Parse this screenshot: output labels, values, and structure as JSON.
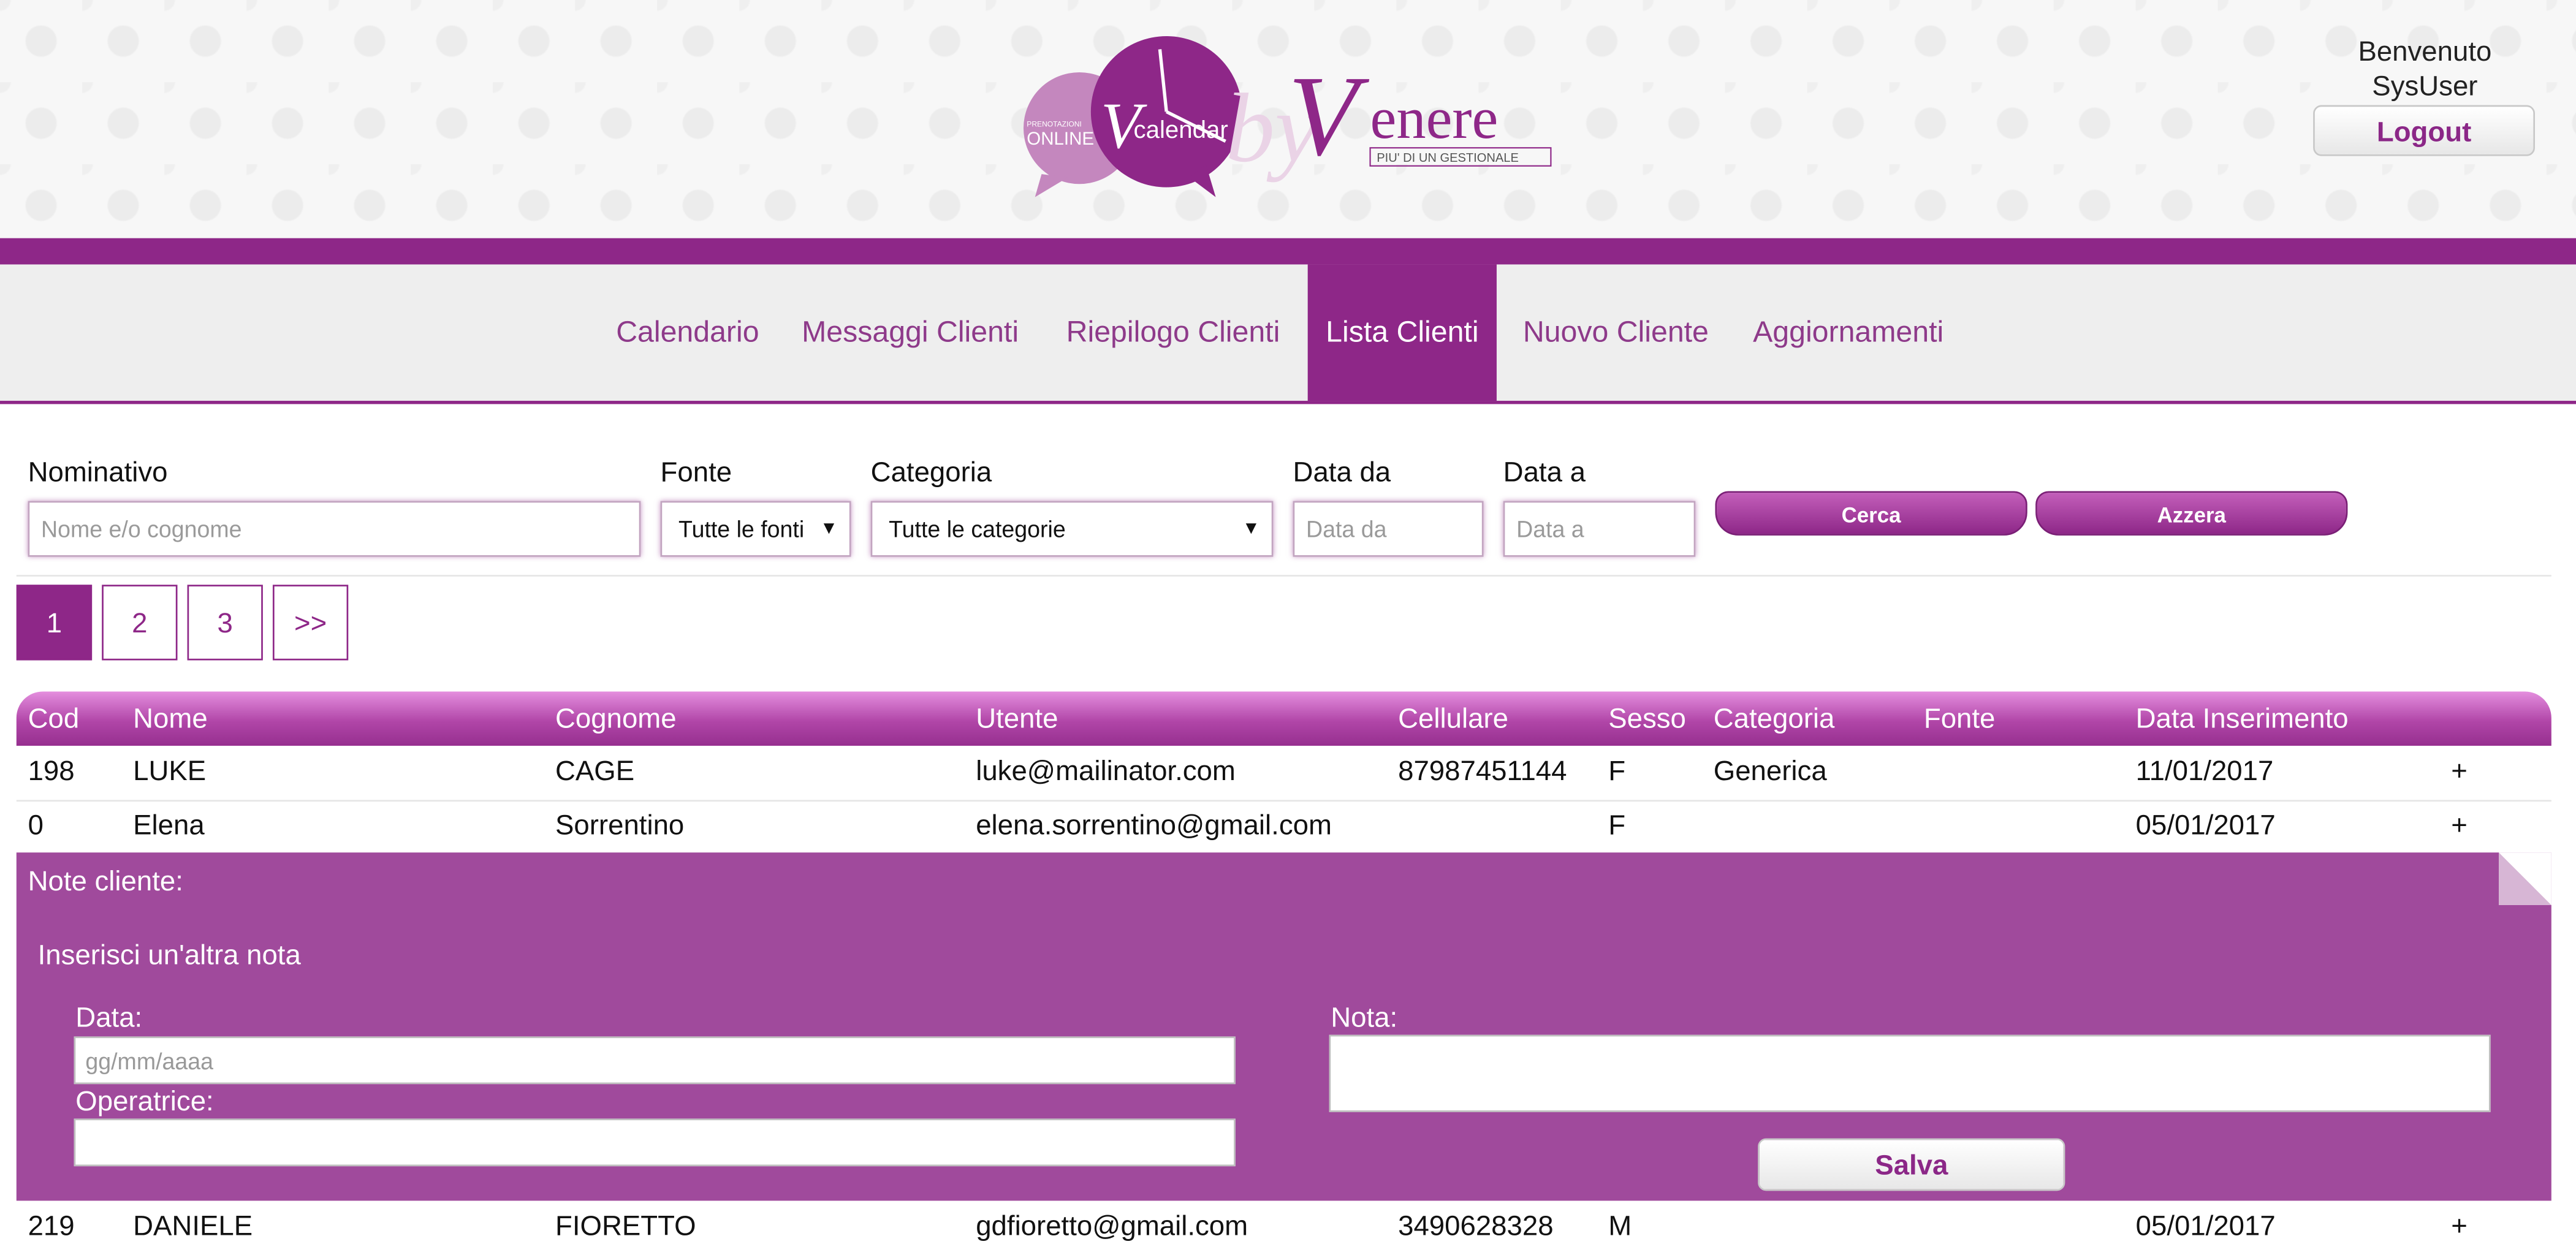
{
  "header": {
    "logo": {
      "badge_text": "PRENOTAZIONI",
      "online_text": "ONLINE",
      "app_name": "calendar",
      "app_initial": "V",
      "by_text": "by",
      "brand_initial": "V",
      "brand_rest": "enere",
      "tagline": "PIU' DI UN GESTIONALE"
    },
    "welcome_line1": "Benvenuto",
    "welcome_line2": "SysUser",
    "logout_label": "Logout"
  },
  "nav": {
    "items": [
      {
        "label": "Calendario"
      },
      {
        "label": "Messaggi Clienti"
      },
      {
        "label": "Riepilogo Clienti"
      },
      {
        "label": "Lista Clienti"
      },
      {
        "label": "Nuovo Cliente"
      },
      {
        "label": "Aggiornamenti"
      }
    ],
    "active": "Lista Clienti"
  },
  "filters": {
    "nominativo_label": "Nominativo",
    "nominativo_placeholder": "Nome e/o cognome",
    "fonte_label": "Fonte",
    "fonte_value": "Tutte le fonti",
    "categoria_label": "Categoria",
    "categoria_value": "Tutte le categorie",
    "data_da_label": "Data da",
    "data_da_placeholder": "Data da",
    "data_a_label": "Data a",
    "data_a_placeholder": "Data a",
    "cerca_label": "Cerca",
    "azzera_label": "Azzera"
  },
  "pagination": {
    "pages": [
      "1",
      "2",
      "3",
      ">>"
    ],
    "current": "1"
  },
  "table": {
    "headers": [
      "Cod",
      "Nome",
      "Cognome",
      "Utente",
      "Cellulare",
      "Sesso",
      "Categoria",
      "Fonte",
      "Data Inserimento"
    ],
    "rows": [
      {
        "cod": "198",
        "nome": "LUKE",
        "cognome": "CAGE",
        "utente": "luke@mailinator.com",
        "cellulare": "87987451144",
        "sesso": "F",
        "categoria": "Generica",
        "fonte": "",
        "data": "11/01/2017",
        "action": "+"
      },
      {
        "cod": "0",
        "nome": "Elena",
        "cognome": "Sorrentino",
        "utente": "elena.sorrentino@gmail.com",
        "cellulare": "",
        "sesso": "F",
        "categoria": "",
        "fonte": "",
        "data": "05/01/2017",
        "action": "+"
      },
      {
        "cod": "219",
        "nome": "DANIELE",
        "cognome": "FIORETTO",
        "utente": "gdfioretto@gmail.com",
        "cellulare": "3490628328",
        "sesso": "M",
        "categoria": "",
        "fonte": "",
        "data": "05/01/2017",
        "action": "+"
      }
    ]
  },
  "notes": {
    "title": "Note cliente:",
    "add_label": "Inserisci un'altra nota",
    "data_label": "Data:",
    "data_placeholder": "gg/mm/aaaa",
    "operatrice_label": "Operatrice:",
    "nota_label": "Nota:",
    "salva_label": "Salva"
  },
  "colors": {
    "brand_purple": "#8e2788",
    "panel_purple": "#a04a9c",
    "nav_background": "#eeeeee"
  }
}
